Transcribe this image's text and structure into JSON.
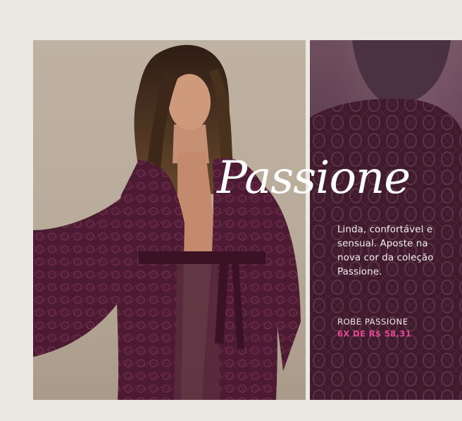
{
  "banner": {
    "headline": "Passione",
    "description": "Linda, confortável e sensual. Aposte na nova cor da coleção Passione.",
    "product_name": "ROBE PASSIONE",
    "product_price": "6X DE R$ 58,31"
  },
  "colors": {
    "background": "#ebe8e4",
    "robe": "#4a1a30",
    "price_accent": "#e8499a",
    "text_light": "#f4eef0"
  }
}
